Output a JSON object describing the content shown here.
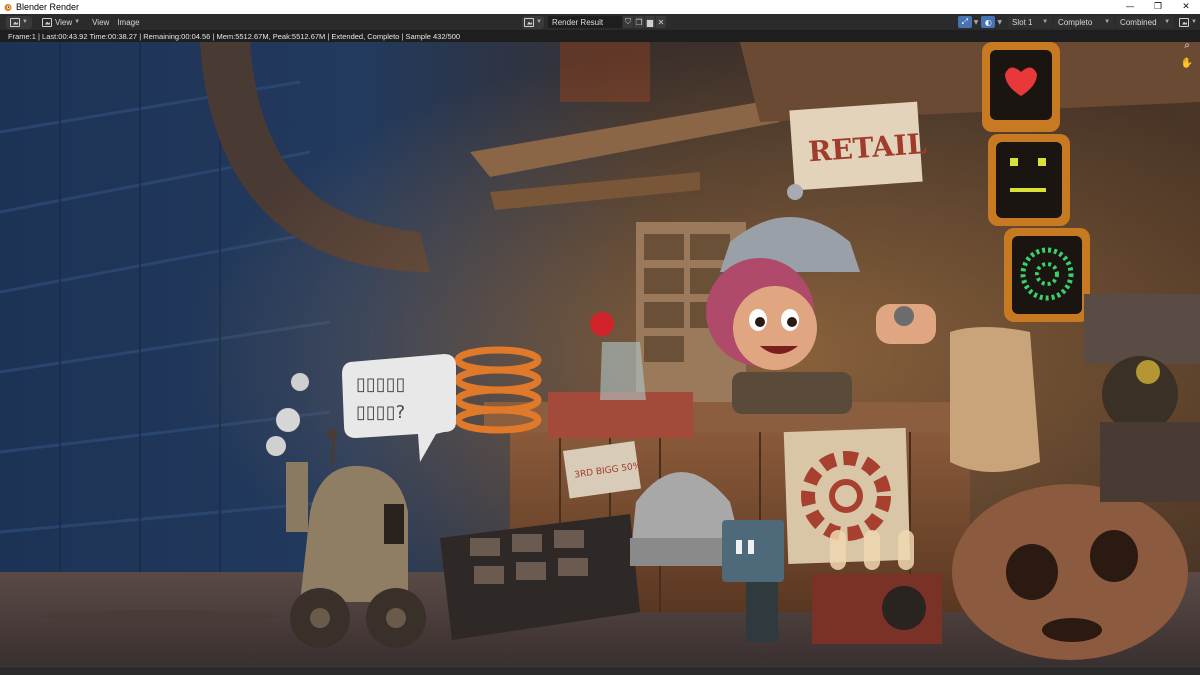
{
  "window": {
    "title": "Blender Render",
    "minimize": "—",
    "maximize": "❐",
    "close": "✕"
  },
  "header": {
    "menus": [
      {
        "label": "View"
      },
      {
        "label": "View"
      },
      {
        "label": "Image"
      }
    ],
    "image_name": "Render Result",
    "slot": "Slot 1",
    "view_layer": "Completo",
    "pass": "Combined"
  },
  "status": {
    "text": "Frame:1 | Last:00:43.92 Time:00:38.27 | Remaining:00:04.56 | Mem:5512.67M, Peak:5512.67M | Extended, Completo | Sample 432/500"
  },
  "scene": {
    "sign_text": "RETAIL",
    "bubble_line1": "▯▯▯▯▯",
    "bubble_line2": "▯▯▯▯?",
    "tag_text": "3RD BIGG 50%"
  },
  "colors": {
    "accent_blue": "#4772b3",
    "header_bg": "#2b2b2b",
    "status_bg": "#1e1e1e"
  }
}
